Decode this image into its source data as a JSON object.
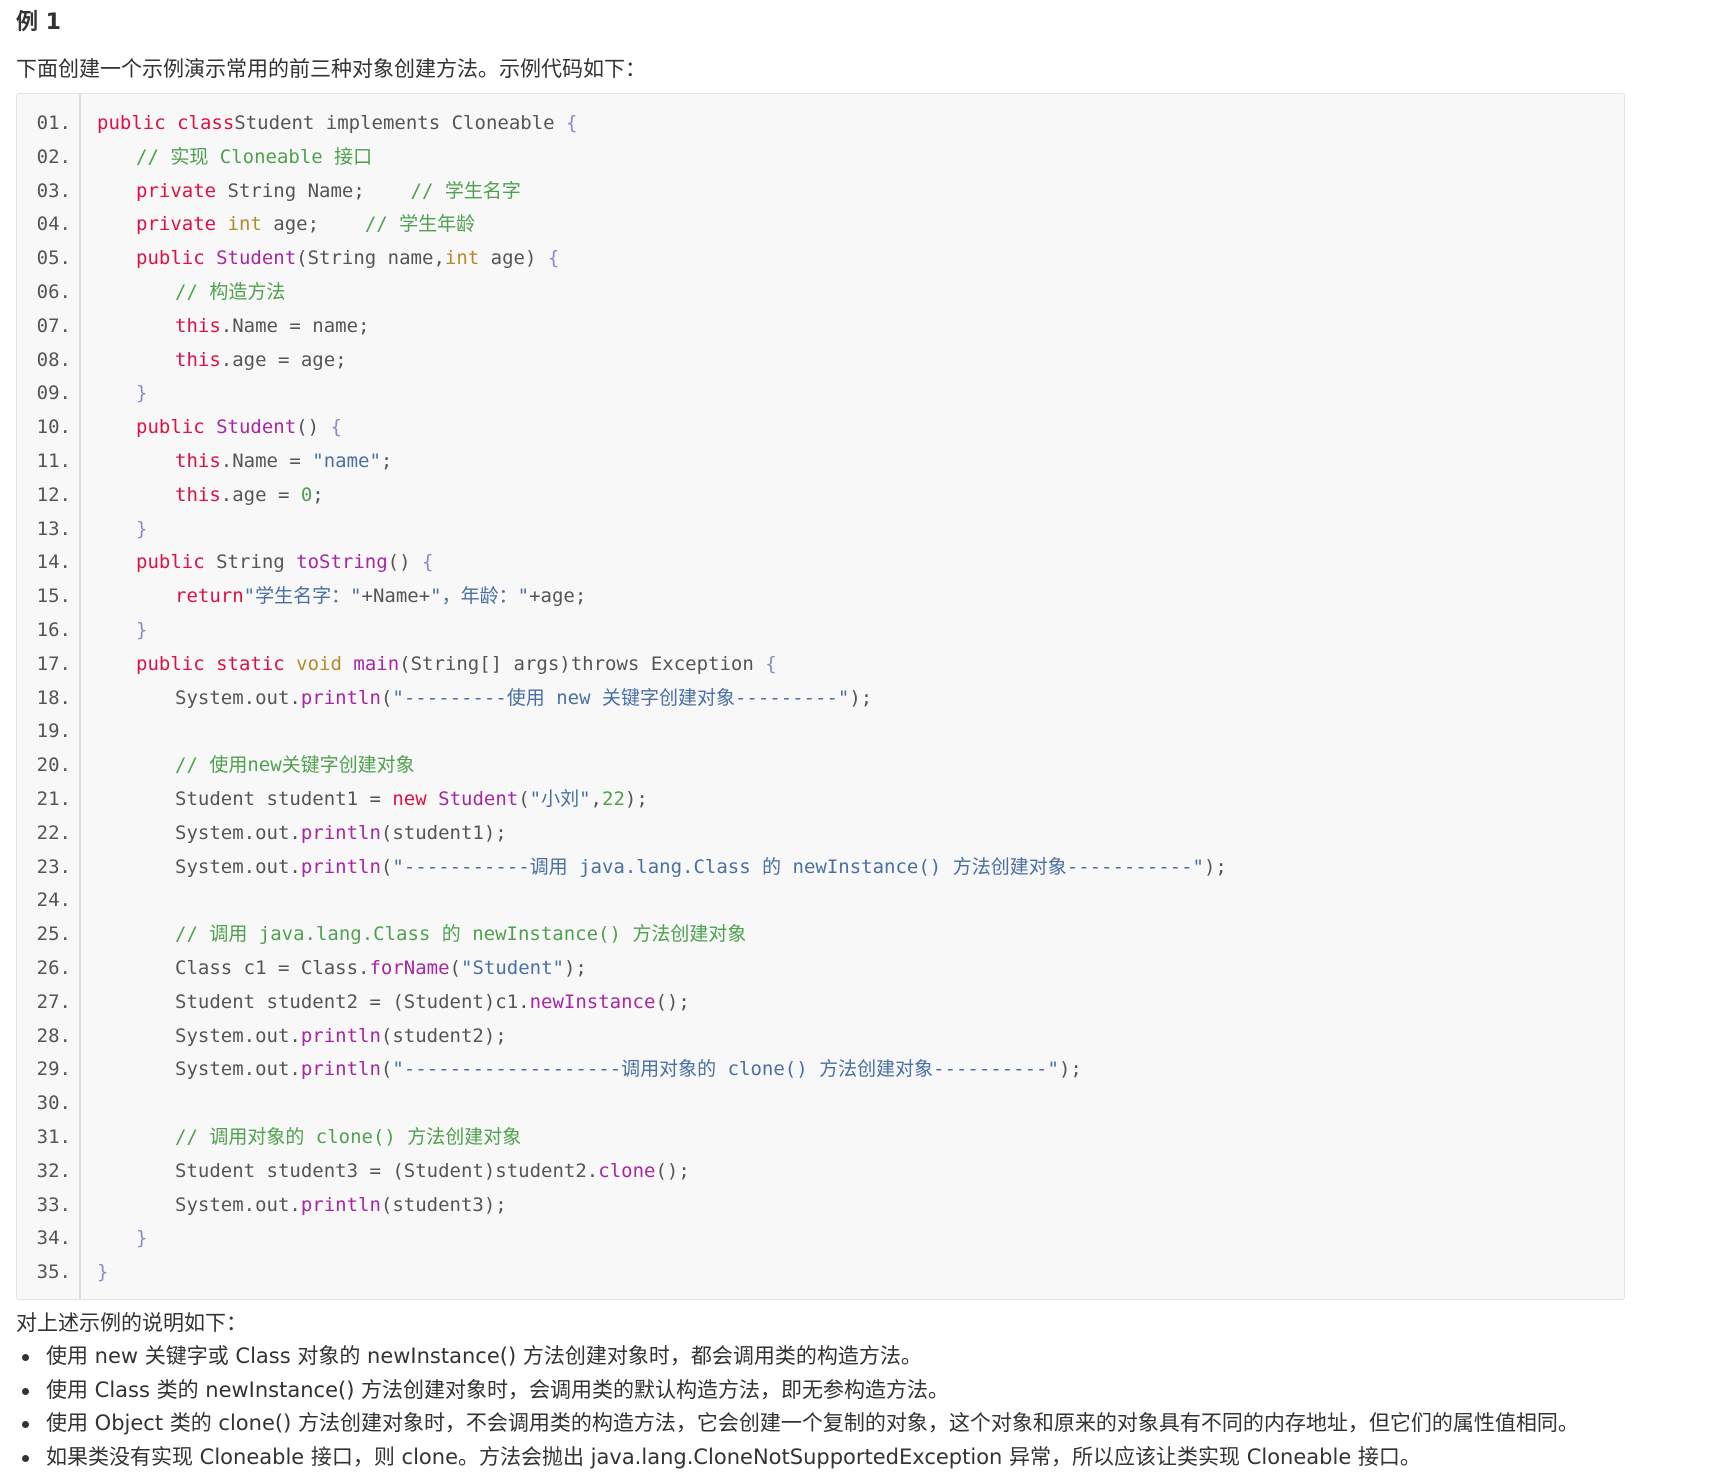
{
  "heading": "例 1",
  "intro": "下面创建一个示例演示常用的前三种对象创建方法。示例代码如下：",
  "code": {
    "lines": [
      {
        "n": "01.",
        "t": [
          [
            "kw",
            "public class"
          ],
          [
            "",
            "Student implements Cloneable "
          ],
          [
            "pu",
            "{"
          ]
        ]
      },
      {
        "n": "02.",
        "i": 1,
        "t": [
          [
            "cm",
            "// 实现 Cloneable 接口"
          ]
        ]
      },
      {
        "n": "03.",
        "i": 1,
        "t": [
          [
            "kw",
            "private"
          ],
          [
            "",
            " String Name;    "
          ],
          [
            "cm",
            "// 学生名字"
          ]
        ]
      },
      {
        "n": "04.",
        "i": 1,
        "t": [
          [
            "kw",
            "private"
          ],
          [
            "",
            " "
          ],
          [
            "ty",
            "int"
          ],
          [
            "",
            " age;    "
          ],
          [
            "cm",
            "// 学生年龄"
          ]
        ]
      },
      {
        "n": "05.",
        "i": 1,
        "t": [
          [
            "kw",
            "public"
          ],
          [
            "",
            " "
          ],
          [
            "fn",
            "Student"
          ],
          [
            "",
            "(String name,"
          ],
          [
            "ty",
            "int"
          ],
          [
            "",
            " age) "
          ],
          [
            "pu",
            "{"
          ]
        ]
      },
      {
        "n": "06.",
        "i": 2,
        "t": [
          [
            "cm",
            "// 构造方法"
          ]
        ]
      },
      {
        "n": "07.",
        "i": 2,
        "t": [
          [
            "kw",
            "this"
          ],
          [
            "",
            ".Name = name;"
          ]
        ]
      },
      {
        "n": "08.",
        "i": 2,
        "t": [
          [
            "kw",
            "this"
          ],
          [
            "",
            ".age = age;"
          ]
        ]
      },
      {
        "n": "09.",
        "i": 1,
        "t": [
          [
            "pu",
            "}"
          ]
        ]
      },
      {
        "n": "10.",
        "i": 1,
        "t": [
          [
            "kw",
            "public"
          ],
          [
            "",
            " "
          ],
          [
            "fn",
            "Student"
          ],
          [
            "",
            "() "
          ],
          [
            "pu",
            "{"
          ]
        ]
      },
      {
        "n": "11.",
        "i": 2,
        "t": [
          [
            "kw",
            "this"
          ],
          [
            "",
            ".Name = "
          ],
          [
            "st",
            "\"name\""
          ],
          [
            "",
            ";"
          ]
        ]
      },
      {
        "n": "12.",
        "i": 2,
        "t": [
          [
            "kw",
            "this"
          ],
          [
            "",
            ".age = "
          ],
          [
            "nu",
            "0"
          ],
          [
            "",
            ";"
          ]
        ]
      },
      {
        "n": "13.",
        "i": 1,
        "t": [
          [
            "pu",
            "}"
          ]
        ]
      },
      {
        "n": "14.",
        "i": 1,
        "t": [
          [
            "kw",
            "public"
          ],
          [
            "",
            " String "
          ],
          [
            "fn",
            "toString"
          ],
          [
            "",
            "() "
          ],
          [
            "pu",
            "{"
          ]
        ]
      },
      {
        "n": "15.",
        "i": 2,
        "t": [
          [
            "kw",
            "return"
          ],
          [
            "st",
            "\"学生名字：\""
          ],
          [
            "",
            "+Name+"
          ],
          [
            "st",
            "\"，年龄：\""
          ],
          [
            "",
            "+age;"
          ]
        ]
      },
      {
        "n": "16.",
        "i": 1,
        "t": [
          [
            "pu",
            "}"
          ]
        ]
      },
      {
        "n": "17.",
        "i": 1,
        "t": [
          [
            "kw",
            "public static"
          ],
          [
            "",
            " "
          ],
          [
            "ty",
            "void"
          ],
          [
            "",
            " "
          ],
          [
            "fn",
            "main"
          ],
          [
            "",
            "(String[] args)throws Exception "
          ],
          [
            "pu",
            "{"
          ]
        ]
      },
      {
        "n": "18.",
        "i": 2,
        "t": [
          [
            "",
            "System.out."
          ],
          [
            "fn",
            "println"
          ],
          [
            "",
            "("
          ],
          [
            "st",
            "\"---------使用 new 关键字创建对象---------\""
          ],
          [
            "",
            ");"
          ]
        ]
      },
      {
        "n": "19.",
        "t": []
      },
      {
        "n": "20.",
        "i": 2,
        "t": [
          [
            "cm",
            "// 使用new关键字创建对象"
          ]
        ]
      },
      {
        "n": "21.",
        "i": 2,
        "t": [
          [
            "",
            "Student student1 = "
          ],
          [
            "kw",
            "new"
          ],
          [
            "",
            " "
          ],
          [
            "fn",
            "Student"
          ],
          [
            "",
            "("
          ],
          [
            "st",
            "\"小刘\""
          ],
          [
            "",
            ","
          ],
          [
            "nu",
            "22"
          ],
          [
            "",
            ");"
          ]
        ]
      },
      {
        "n": "22.",
        "i": 2,
        "t": [
          [
            "",
            "System.out."
          ],
          [
            "fn",
            "println"
          ],
          [
            "",
            "(student1);"
          ]
        ]
      },
      {
        "n": "23.",
        "i": 2,
        "t": [
          [
            "",
            "System.out."
          ],
          [
            "fn",
            "println"
          ],
          [
            "",
            "("
          ],
          [
            "st",
            "\"-----------调用 java.lang.Class 的 newInstance() 方法创建对象-----------\""
          ],
          [
            "",
            ");"
          ]
        ]
      },
      {
        "n": "24.",
        "t": []
      },
      {
        "n": "25.",
        "i": 2,
        "t": [
          [
            "cm",
            "// 调用 java.lang.Class 的 newInstance() 方法创建对象"
          ]
        ]
      },
      {
        "n": "26.",
        "i": 2,
        "t": [
          [
            "",
            "Class c1 = Class."
          ],
          [
            "fn",
            "forName"
          ],
          [
            "",
            "("
          ],
          [
            "st",
            "\"Student\""
          ],
          [
            "",
            ");"
          ]
        ]
      },
      {
        "n": "27.",
        "i": 2,
        "t": [
          [
            "",
            "Student student2 = (Student)c1."
          ],
          [
            "fn",
            "newInstance"
          ],
          [
            "",
            "();"
          ]
        ]
      },
      {
        "n": "28.",
        "i": 2,
        "t": [
          [
            "",
            "System.out."
          ],
          [
            "fn",
            "println"
          ],
          [
            "",
            "(student2);"
          ]
        ]
      },
      {
        "n": "29.",
        "i": 2,
        "t": [
          [
            "",
            "System.out."
          ],
          [
            "fn",
            "println"
          ],
          [
            "",
            "("
          ],
          [
            "st",
            "\"-------------------调用对象的 clone() 方法创建对象----------\""
          ],
          [
            "",
            ");"
          ]
        ]
      },
      {
        "n": "30.",
        "t": []
      },
      {
        "n": "31.",
        "i": 2,
        "t": [
          [
            "cm",
            "// 调用对象的 clone() 方法创建对象"
          ]
        ]
      },
      {
        "n": "32.",
        "i": 2,
        "t": [
          [
            "",
            "Student student3 = (Student)student2."
          ],
          [
            "fn",
            "clone"
          ],
          [
            "",
            "();"
          ]
        ]
      },
      {
        "n": "33.",
        "i": 2,
        "t": [
          [
            "",
            "System.out."
          ],
          [
            "fn",
            "println"
          ],
          [
            "",
            "(student3);"
          ]
        ]
      },
      {
        "n": "34.",
        "i": 1,
        "t": [
          [
            "pu",
            "}"
          ]
        ]
      },
      {
        "n": "35.",
        "t": [
          [
            "pu",
            "}"
          ]
        ]
      }
    ]
  },
  "notes": {
    "title": "对上述示例的说明如下：",
    "items": [
      "使用 new 关键字或 Class 对象的 newInstance() 方法创建对象时，都会调用类的构造方法。",
      "使用 Class 类的 newInstance() 方法创建对象时，会调用类的默认构造方法，即无参构造方法。",
      "使用 Object 类的 clone() 方法创建对象时，不会调用类的构造方法，它会创建一个复制的对象，这个对象和原来的对象具有不同的内存地址，但它们的属性值相同。",
      "如果类没有实现 Cloneable 接口，则 clone。方法会抛出 java.lang.CloneNotSupportedException 异常，所以应该让类实现 Cloneable 接口。"
    ]
  }
}
